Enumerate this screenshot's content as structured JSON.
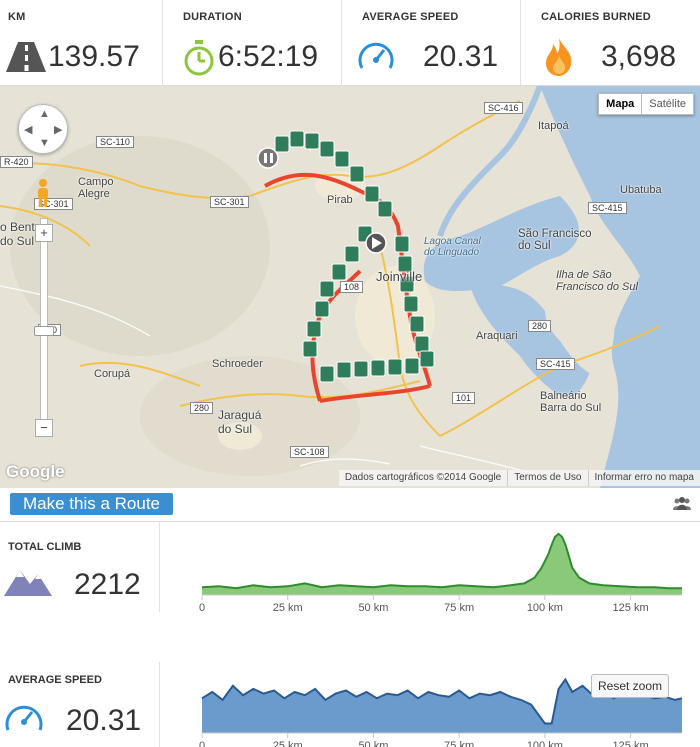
{
  "stats": {
    "distance": {
      "label": "KM",
      "value": "139.57",
      "icon": "road-icon"
    },
    "duration": {
      "label": "DURATION",
      "value": "6:52:19",
      "icon": "stopwatch-icon"
    },
    "avg_speed": {
      "label": "AVERAGE SPEED",
      "value": "20.31",
      "icon": "speedometer-icon"
    },
    "calories": {
      "label": "CALORIES BURNED",
      "value": "3,698",
      "icon": "flame-icon"
    }
  },
  "map": {
    "type_buttons": {
      "map": "Mapa",
      "satellite": "Satélite"
    },
    "labels": {
      "itapoa": "Itapoá",
      "campo_alegre": "Campo\nAlegre",
      "ubatuba": "Ubatuba",
      "sao_francisco": "São Francisco\ndo Sul",
      "ilha": "Ilha de São\nFrancisco do Sul",
      "lagoa": "Lagoa Canal\ndo Linguado",
      "schroeder": "Schroeder",
      "corupa": "Corupá",
      "jaragua": "Jaraguá\ndo Sul",
      "araquari": "Araquari",
      "balneario": "Balneário\nBarra do Sul",
      "joinville": "Joinville",
      "pirabeiraba": "Pirab",
      "sao_bento": "o Bent\ndo Sul"
    },
    "shields": [
      "SC-416",
      "SC-110",
      "R-420",
      "SC-301",
      "SC-301",
      "SC-415",
      "SC-415",
      "280",
      "280",
      "280",
      "101",
      "SC-108",
      "SC-108",
      "280",
      "108"
    ],
    "footer": {
      "data": "Dados cartográficos ©2014 Google",
      "terms": "Termos de Uso",
      "report": "Informar erro no mapa"
    },
    "logo": "Google",
    "route_color": "#e8442e",
    "marker_color": "#2f7d5b"
  },
  "route_bar": {
    "button_label": "Make this a Route",
    "icon": "people-icon"
  },
  "climb": {
    "label": "TOTAL CLIMB",
    "value": "2212",
    "icon": "mountain-icon"
  },
  "speed_panel": {
    "label": "AVERAGE SPEED",
    "value": "20.31",
    "icon": "speedometer-icon"
  },
  "chart_data": [
    {
      "type": "area",
      "title": "",
      "xlabel": "",
      "ylabel": "",
      "x_ticks": [
        "0",
        "25 km",
        "50 km",
        "75 km",
        "100 km",
        "125 km"
      ],
      "x_tick_values": [
        0,
        25,
        50,
        75,
        100,
        125
      ],
      "xlim": [
        0,
        140
      ],
      "color": "#2e8b2e",
      "fill": "#7dc36b",
      "series": [
        {
          "x": [
            0,
            5,
            10,
            15,
            20,
            25,
            30,
            35,
            40,
            45,
            50,
            55,
            60,
            65,
            70,
            75,
            80,
            85,
            90,
            94,
            97,
            99,
            101,
            102,
            103,
            104,
            105,
            106,
            107,
            108,
            110,
            113,
            117,
            122,
            127,
            132,
            136,
            140
          ],
          "values": [
            8,
            9,
            7,
            10,
            8,
            9,
            12,
            8,
            10,
            9,
            8,
            10,
            9,
            9,
            8,
            10,
            9,
            8,
            10,
            12,
            18,
            28,
            42,
            52,
            60,
            63,
            60,
            52,
            40,
            28,
            18,
            12,
            10,
            9,
            8,
            8,
            7,
            7
          ]
        }
      ]
    },
    {
      "type": "area",
      "title": "",
      "xlabel": "",
      "ylabel": "",
      "x_ticks": [
        "0",
        "25 km",
        "50 km",
        "75 km",
        "100 km",
        "125 km"
      ],
      "x_tick_values": [
        0,
        25,
        50,
        75,
        100,
        125
      ],
      "xlim": [
        0,
        140
      ],
      "color": "#2a5a94",
      "fill": "#5b8fc7",
      "reset_zoom_label": "Reset zoom",
      "series": [
        {
          "x": [
            0,
            3,
            6,
            9,
            12,
            15,
            18,
            21,
            24,
            27,
            30,
            33,
            36,
            39,
            42,
            45,
            48,
            51,
            54,
            57,
            60,
            63,
            66,
            69,
            72,
            75,
            78,
            81,
            84,
            87,
            90,
            93,
            96,
            98,
            100,
            102,
            104,
            106,
            108,
            111,
            114,
            117,
            120,
            123,
            126,
            129,
            132,
            135,
            138,
            140
          ],
          "values": [
            22,
            26,
            21,
            30,
            24,
            28,
            25,
            27,
            22,
            26,
            24,
            28,
            21,
            25,
            27,
            23,
            26,
            22,
            25,
            24,
            27,
            22,
            26,
            24,
            23,
            27,
            22,
            25,
            24,
            26,
            23,
            21,
            18,
            12,
            6,
            6,
            28,
            34,
            26,
            30,
            24,
            28,
            22,
            25,
            23,
            24,
            22,
            23,
            21,
            22
          ]
        }
      ]
    }
  ]
}
